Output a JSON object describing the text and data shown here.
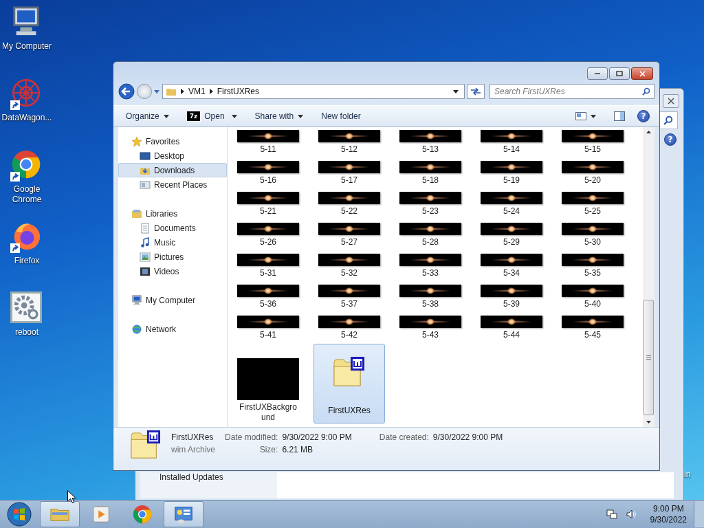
{
  "desktop_icons": [
    {
      "label": "My Computer",
      "kind": "computer"
    },
    {
      "label": "DataWagon...",
      "kind": "datawagon"
    },
    {
      "label": "Google Chrome",
      "kind": "chrome"
    },
    {
      "label": "Firefox",
      "kind": "firefox"
    },
    {
      "label": "reboot",
      "kind": "gear"
    }
  ],
  "background_window": {
    "pane_item": "Installed Updates",
    "edge_text": "in",
    "help_label": "?"
  },
  "explorer": {
    "address": [
      "VM1",
      "FirstUXRes"
    ],
    "search": {
      "placeholder": "Search FirstUXRes"
    },
    "help_label": "?",
    "toolbar": [
      {
        "label": "Organize",
        "kind": "menu"
      },
      {
        "label": "Open",
        "kind": "open",
        "icon_text": "7z"
      },
      {
        "label": "Share with",
        "kind": "menu"
      },
      {
        "label": "New folder",
        "kind": "plain"
      }
    ],
    "nav": [
      {
        "label": "Favorites",
        "kind": "star",
        "selected": false,
        "children": [
          {
            "label": "Desktop",
            "kind": "desktop",
            "selected": false
          },
          {
            "label": "Downloads",
            "kind": "downloads",
            "selected": true
          },
          {
            "label": "Recent Places",
            "kind": "places",
            "selected": false
          }
        ]
      },
      {
        "label": "Libraries",
        "kind": "library",
        "selected": false,
        "children": [
          {
            "label": "Documents",
            "kind": "documents",
            "selected": false
          },
          {
            "label": "Music",
            "kind": "music",
            "selected": false
          },
          {
            "label": "Pictures",
            "kind": "pictures",
            "selected": false
          },
          {
            "label": "Videos",
            "kind": "videos",
            "selected": false
          }
        ]
      },
      {
        "label": "My Computer",
        "kind": "computer",
        "selected": false
      },
      {
        "label": "Network",
        "kind": "network",
        "selected": false
      }
    ],
    "files": [
      {
        "name": "5-11",
        "kind": "image",
        "selected": false
      },
      {
        "name": "5-12",
        "kind": "image",
        "selected": false
      },
      {
        "name": "5-13",
        "kind": "image",
        "selected": false
      },
      {
        "name": "5-14",
        "kind": "image",
        "selected": false
      },
      {
        "name": "5-15",
        "kind": "image",
        "selected": false
      },
      {
        "name": "5-16",
        "kind": "image",
        "selected": false
      },
      {
        "name": "5-17",
        "kind": "image",
        "selected": false
      },
      {
        "name": "5-18",
        "kind": "image",
        "selected": false
      },
      {
        "name": "5-19",
        "kind": "image",
        "selected": false
      },
      {
        "name": "5-20",
        "kind": "image",
        "selected": false
      },
      {
        "name": "5-21",
        "kind": "image",
        "selected": false
      },
      {
        "name": "5-22",
        "kind": "image",
        "selected": false
      },
      {
        "name": "5-23",
        "kind": "image",
        "selected": false
      },
      {
        "name": "5-24",
        "kind": "image",
        "selected": false
      },
      {
        "name": "5-25",
        "kind": "image",
        "selected": false
      },
      {
        "name": "5-26",
        "kind": "image",
        "selected": false
      },
      {
        "name": "5-27",
        "kind": "image",
        "selected": false
      },
      {
        "name": "5-28",
        "kind": "image",
        "selected": false
      },
      {
        "name": "5-29",
        "kind": "image",
        "selected": false
      },
      {
        "name": "5-30",
        "kind": "image",
        "selected": false
      },
      {
        "name": "5-31",
        "kind": "image",
        "selected": false
      },
      {
        "name": "5-32",
        "kind": "image",
        "selected": false
      },
      {
        "name": "5-33",
        "kind": "image",
        "selected": false
      },
      {
        "name": "5-34",
        "kind": "image",
        "selected": false
      },
      {
        "name": "5-35",
        "kind": "image",
        "selected": false
      },
      {
        "name": "5-36",
        "kind": "image",
        "selected": false
      },
      {
        "name": "5-37",
        "kind": "image",
        "selected": false
      },
      {
        "name": "5-38",
        "kind": "image",
        "selected": false
      },
      {
        "name": "5-39",
        "kind": "image",
        "selected": false
      },
      {
        "name": "5-40",
        "kind": "image",
        "selected": false
      },
      {
        "name": "5-41",
        "kind": "image",
        "selected": false
      },
      {
        "name": "5-42",
        "kind": "image",
        "selected": false
      },
      {
        "name": "5-43",
        "kind": "image",
        "selected": false
      },
      {
        "name": "5-44",
        "kind": "image",
        "selected": false
      },
      {
        "name": "5-45",
        "kind": "image",
        "selected": false
      },
      {
        "name": "FirstUXBackground",
        "kind": "large_image",
        "selected": false
      },
      {
        "name": "FirstUXRes",
        "kind": "archive",
        "selected": true
      }
    ],
    "details": {
      "name": "FirstUXRes",
      "type": "wim Archive",
      "fields": [
        {
          "label": "Date modified:",
          "value": "9/30/2022 9:00 PM"
        },
        {
          "label": "Date created:",
          "value": "9/30/2022 9:00 PM"
        },
        {
          "label": "Size:",
          "value": "6.21 MB"
        }
      ]
    }
  },
  "taskbar": {
    "items": [
      {
        "kind": "explorer",
        "active": true
      },
      {
        "kind": "media",
        "active": false
      },
      {
        "kind": "chrome",
        "active": false
      },
      {
        "kind": "control",
        "active": true
      }
    ],
    "time": "9:00 PM",
    "date": "9/30/2022"
  }
}
